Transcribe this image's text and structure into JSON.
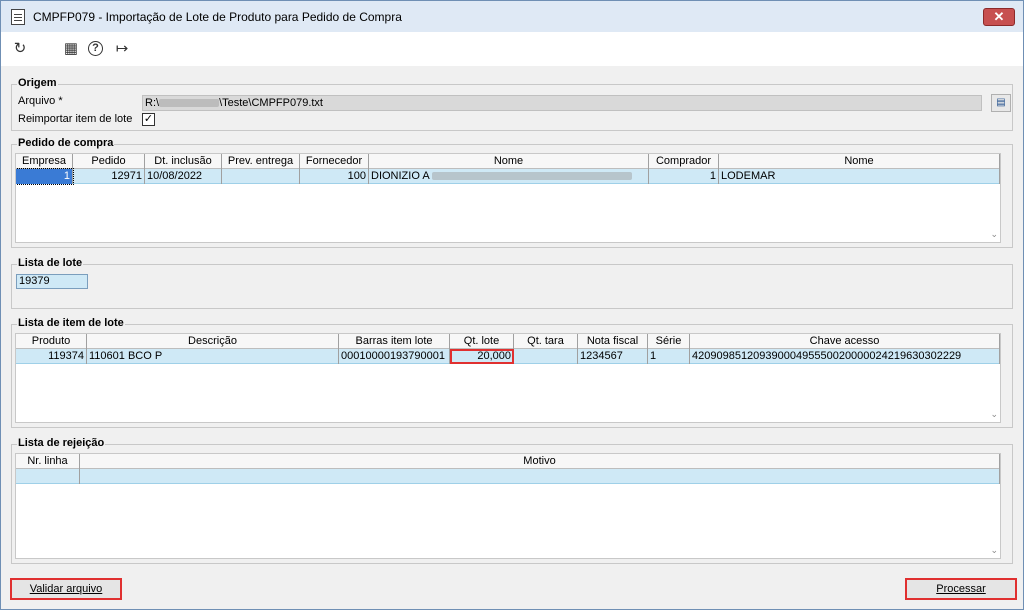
{
  "window": {
    "title": "CMPFP079 - Importação de Lote de Produto para Pedido de Compra",
    "close_label": "✕"
  },
  "toolbar": [
    {
      "icon": "refresh-icon",
      "glyph": "↻"
    },
    {
      "icon": "calendar-icon",
      "glyph": "▦"
    },
    {
      "icon": "help-icon",
      "glyph": "?"
    },
    {
      "icon": "exit-icon",
      "glyph": "↦"
    }
  ],
  "origem": {
    "legend": "Origem",
    "arquivo_label": "Arquivo *",
    "arquivo_prefix": "R:\\",
    "arquivo_suffix": "\\Teste\\CMPFP079.txt",
    "reimportar_label": "Reimportar item de lote",
    "reimportar_checked": "✓"
  },
  "pedido": {
    "legend": "Pedido de compra",
    "headers": [
      "Empresa",
      "Pedido",
      "Dt. inclusão",
      "Prev. entrega",
      "Fornecedor",
      "Nome",
      "Comprador",
      "Nome"
    ],
    "row": {
      "empresa": "1",
      "pedido": "12971",
      "dt_inclusao": "10/08/2022",
      "prev_entrega": "",
      "fornecedor": "100",
      "nome_fornecedor": "DIONIZIO A",
      "comprador": "1",
      "nome_comprador": "LODEMAR"
    }
  },
  "lista_lote": {
    "legend": "Lista de lote",
    "value": "19379"
  },
  "lista_item": {
    "legend": "Lista de item de lote",
    "headers": [
      "Produto",
      "Descrição",
      "Barras item lote",
      "Qt. lote",
      "Qt. tara",
      "Nota fiscal",
      "Série",
      "Chave acesso"
    ],
    "row": {
      "produto": "119374",
      "descricao": "110601 BCO P",
      "barras": "00010000193790001",
      "qt_lote": "20,000",
      "qt_tara": "",
      "nota_fiscal": "1234567",
      "serie": "1",
      "chave": "42090985120939000495550020000024219630302229"
    }
  },
  "rejeicao": {
    "legend": "Lista de rejeição",
    "headers": [
      "Nr. linha",
      "Motivo"
    ]
  },
  "buttons": {
    "validar": "Validar arquivo",
    "processar": "Processar"
  },
  "colors": {
    "accent_row": "#cfe9f6",
    "highlight": "#e03030",
    "close": "#c75050"
  }
}
